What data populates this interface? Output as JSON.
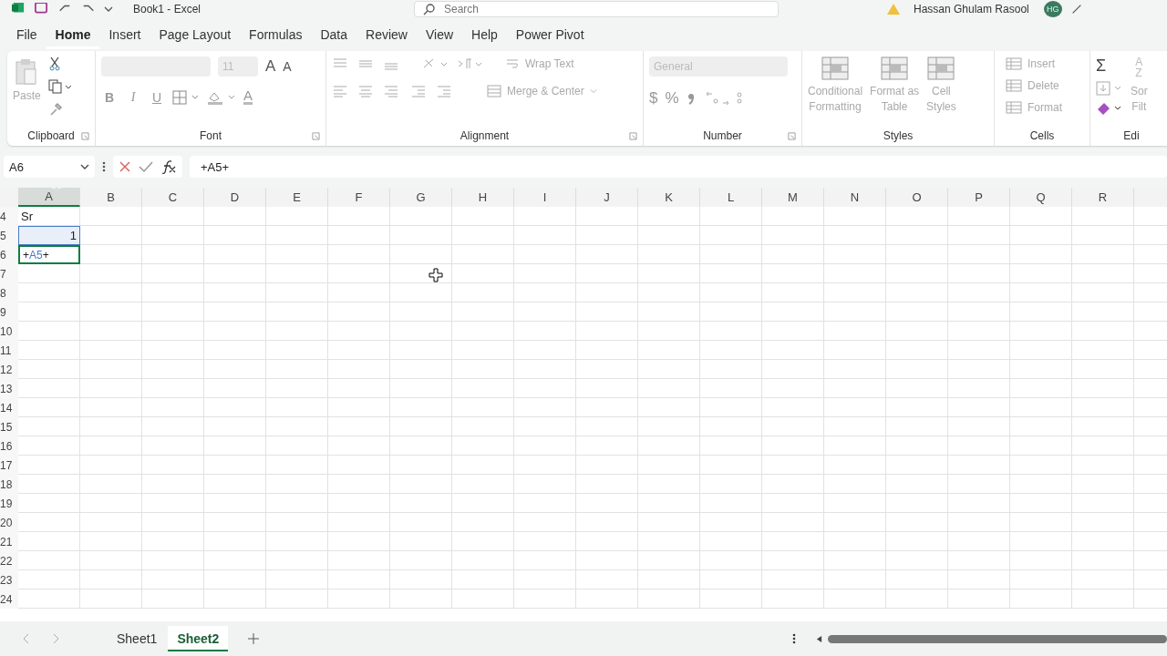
{
  "title_bar": {
    "title": "Book1 - Excel",
    "search": {
      "placeholder": "Search"
    },
    "user": "Hassan Ghulam Rasool",
    "avatar": "HG"
  },
  "tabs": [
    {
      "label": "File",
      "selected": false
    },
    {
      "label": "Home",
      "selected": true
    },
    {
      "label": "Insert",
      "selected": false
    },
    {
      "label": "Page Layout",
      "selected": false
    },
    {
      "label": "Formulas",
      "selected": false
    },
    {
      "label": "Data",
      "selected": false
    },
    {
      "label": "Review",
      "selected": false
    },
    {
      "label": "View",
      "selected": false
    },
    {
      "label": "Help",
      "selected": false
    },
    {
      "label": "Power Pivot",
      "selected": false
    }
  ],
  "ribbon": {
    "groups": [
      {
        "kind": "clipboard",
        "label": "Clipboard",
        "paste": {
          "label": "Paste",
          "disabled": true
        }
      },
      {
        "kind": "font",
        "label": "Font",
        "font_size": "11",
        "size_buttons": [
          "A",
          "A"
        ],
        "format_buttons": [
          "B",
          "I",
          "U"
        ],
        "font_color": "A"
      },
      {
        "kind": "alignment",
        "label": "Alignment",
        "wrap": {
          "label": "Wrap Text",
          "disabled": true
        },
        "merge": {
          "label": "Merge & Center",
          "disabled": true
        }
      },
      {
        "kind": "number",
        "label": "Number",
        "format": "General",
        "symbols": [
          "$",
          "%"
        ]
      },
      {
        "kind": "styles",
        "label": "Styles",
        "commands": [
          {
            "label": "Conditional",
            "label2": "Formatting",
            "disabled": true
          },
          {
            "label": "Format as",
            "label2": "Table",
            "disabled": true
          },
          {
            "label": "Cell",
            "label2": "Styles",
            "disabled": true
          }
        ]
      },
      {
        "kind": "cells",
        "label": "Cells",
        "commands": [
          {
            "label": "Insert",
            "disabled": true
          },
          {
            "label": "Delete",
            "disabled": true
          },
          {
            "label": "Format",
            "disabled": true
          }
        ]
      },
      {
        "kind": "editing",
        "label": "Edi",
        "sum": "Σ",
        "sort_letters": [
          "A",
          "Z"
        ],
        "sort_label": "Sor",
        "filter_label": "Filt"
      }
    ]
  },
  "formula_bar": {
    "name_box": "A6",
    "formula": "+A5+"
  },
  "sheet": {
    "columns": [
      {
        "label": "A",
        "selected": true
      },
      {
        "label": "B",
        "selected": false
      },
      {
        "label": "C",
        "selected": false
      },
      {
        "label": "D",
        "selected": false
      },
      {
        "label": "E",
        "selected": false
      },
      {
        "label": "F",
        "selected": false
      },
      {
        "label": "G",
        "selected": false
      },
      {
        "label": "H",
        "selected": false
      },
      {
        "label": "I",
        "selected": false
      },
      {
        "label": "J",
        "selected": false
      },
      {
        "label": "K",
        "selected": false
      },
      {
        "label": "L",
        "selected": false
      },
      {
        "label": "M",
        "selected": false
      },
      {
        "label": "N",
        "selected": false
      },
      {
        "label": "O",
        "selected": false
      },
      {
        "label": "P",
        "selected": false
      },
      {
        "label": "Q",
        "selected": false
      },
      {
        "label": "R",
        "selected": false
      }
    ],
    "rows": [
      {
        "label": "4",
        "cells": [
          {
            "text": "Sr",
            "kind": "text"
          }
        ]
      },
      {
        "label": "5",
        "cells": [
          {
            "text": "1",
            "kind": "referenced"
          }
        ]
      },
      {
        "label": "6",
        "cells": [
          {
            "kind": "editing",
            "parts": [
              {
                "text": "+",
                "ref": false
              },
              {
                "text": "A5",
                "ref": true
              },
              {
                "text": "+",
                "ref": false
              }
            ]
          }
        ]
      },
      {
        "label": "7",
        "cells": []
      },
      {
        "label": "8",
        "cells": []
      },
      {
        "label": "9",
        "cells": []
      },
      {
        "label": "10",
        "cells": []
      },
      {
        "label": "11",
        "cells": []
      },
      {
        "label": "12",
        "cells": []
      },
      {
        "label": "13",
        "cells": []
      },
      {
        "label": "14",
        "cells": []
      },
      {
        "label": "15",
        "cells": []
      },
      {
        "label": "16",
        "cells": []
      },
      {
        "label": "17",
        "cells": []
      },
      {
        "label": "18",
        "cells": []
      },
      {
        "label": "19",
        "cells": []
      },
      {
        "label": "20",
        "cells": []
      },
      {
        "label": "21",
        "cells": []
      },
      {
        "label": "22",
        "cells": []
      },
      {
        "label": "23",
        "cells": []
      },
      {
        "label": "24",
        "cells": []
      }
    ]
  },
  "sheet_tabs": [
    {
      "label": "Sheet1",
      "selected": false
    },
    {
      "label": "Sheet2",
      "selected": true
    }
  ]
}
